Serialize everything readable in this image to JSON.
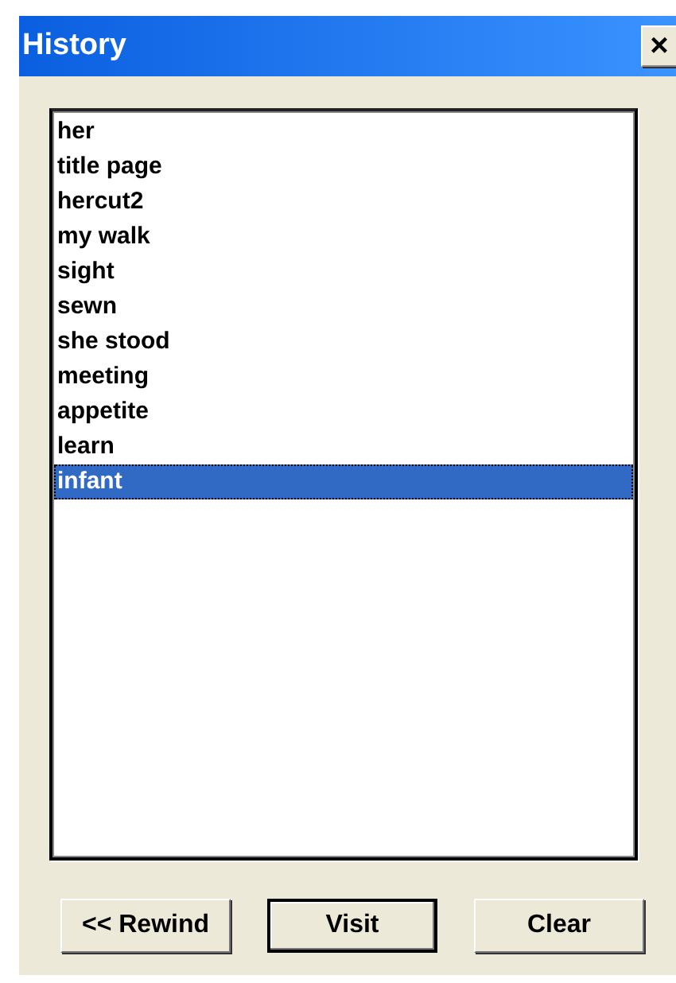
{
  "window": {
    "title": "History",
    "close": "×"
  },
  "history": {
    "items": [
      {
        "label": "her",
        "selected": false
      },
      {
        "label": "title page",
        "selected": false
      },
      {
        "label": "hercut2",
        "selected": false
      },
      {
        "label": "my walk",
        "selected": false
      },
      {
        "label": "sight",
        "selected": false
      },
      {
        "label": "sewn",
        "selected": false
      },
      {
        "label": "she stood",
        "selected": false
      },
      {
        "label": "meeting",
        "selected": false
      },
      {
        "label": "appetite",
        "selected": false
      },
      {
        "label": "learn",
        "selected": false
      },
      {
        "label": "infant",
        "selected": true
      }
    ]
  },
  "buttons": [
    {
      "label": "<< Rewind",
      "default": false
    },
    {
      "label": "Visit",
      "default": true
    },
    {
      "label": "Clear",
      "default": false
    }
  ]
}
